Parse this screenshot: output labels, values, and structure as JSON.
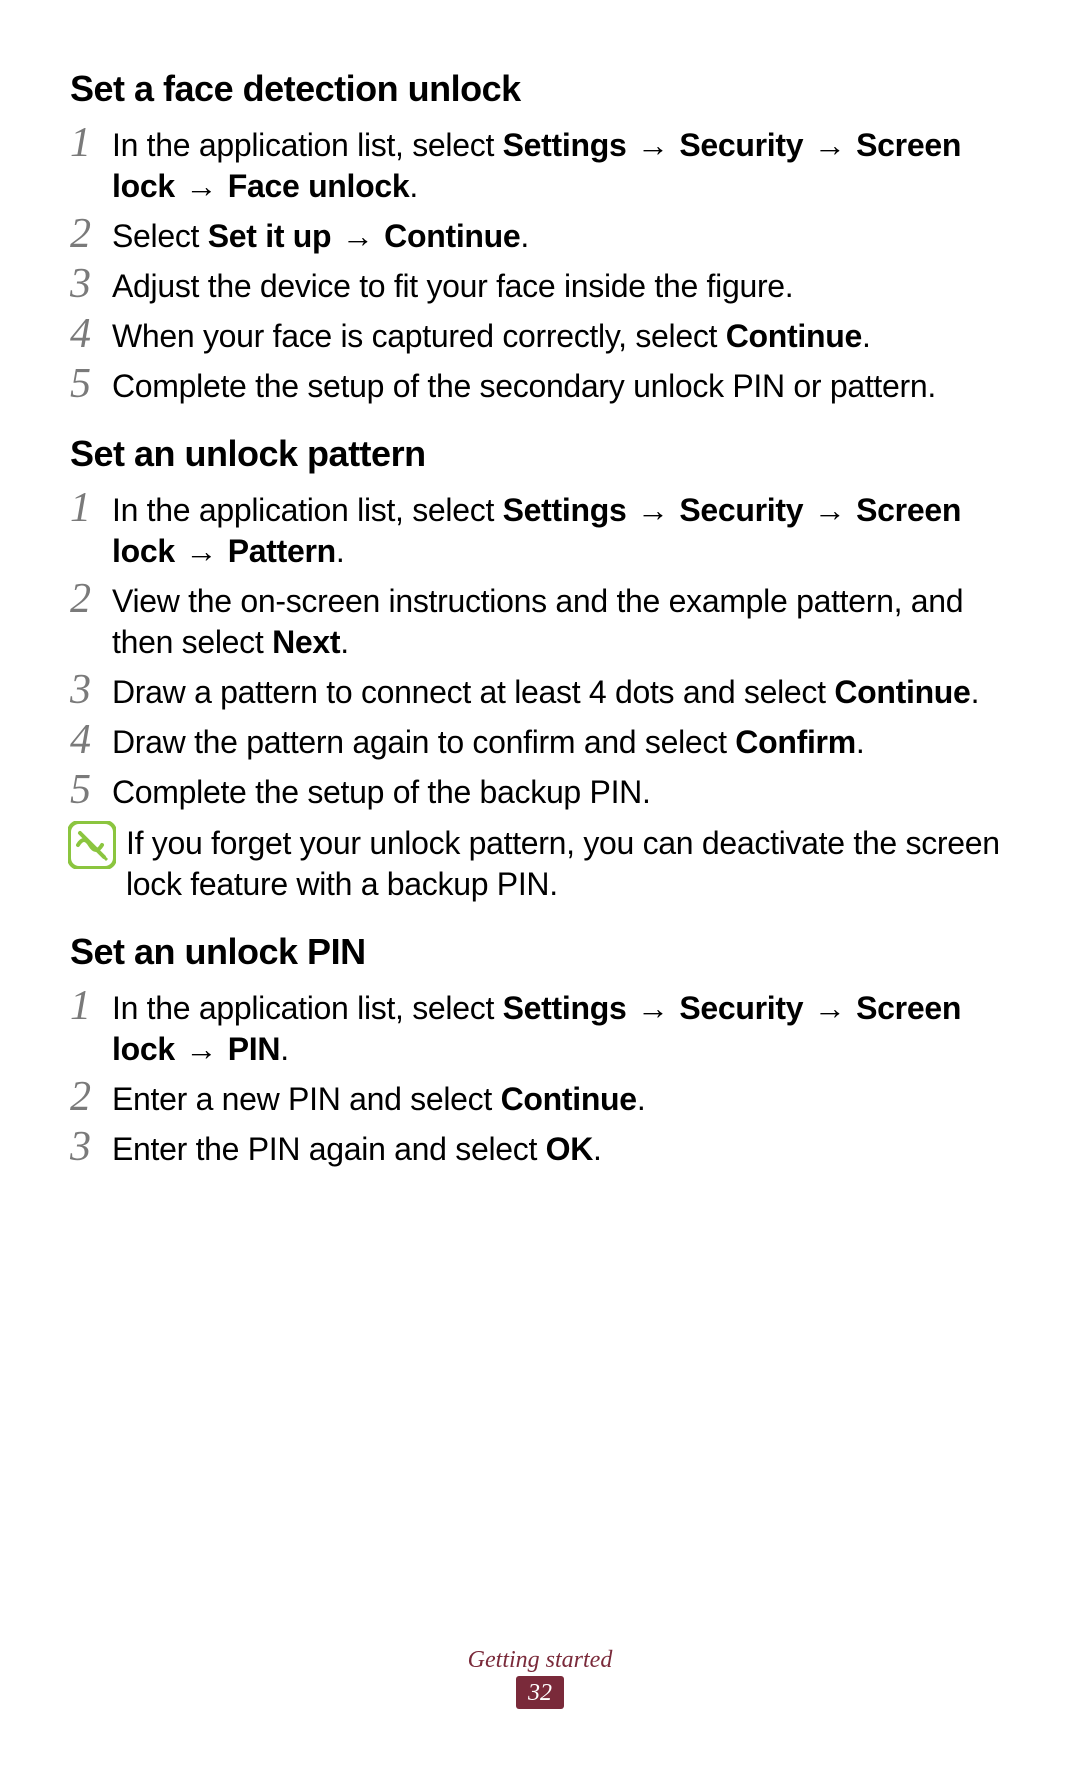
{
  "sectionA": {
    "heading": "Set a face detection unlock",
    "steps": {
      "s1": {
        "num": "1",
        "pre": "In the application list, select ",
        "b1": "Settings",
        "a1": " → ",
        "b2": "Security",
        "a2": " → ",
        "b3": "Screen lock",
        "a3": " → ",
        "b4": "Face unlock",
        "post": "."
      },
      "s2": {
        "num": "2",
        "pre": "Select ",
        "b1": "Set it up",
        "a1": " → ",
        "b2": "Continue",
        "post": "."
      },
      "s3": {
        "num": "3",
        "text": "Adjust the device to fit your face inside the figure."
      },
      "s4": {
        "num": "4",
        "pre": "When your face is captured correctly, select ",
        "b1": "Continue",
        "post": "."
      },
      "s5": {
        "num": "5",
        "text": "Complete the setup of the secondary unlock PIN or pattern."
      }
    }
  },
  "sectionB": {
    "heading": "Set an unlock pattern",
    "steps": {
      "s1": {
        "num": "1",
        "pre": "In the application list, select ",
        "b1": "Settings",
        "a1": " → ",
        "b2": "Security",
        "a2": " → ",
        "b3": "Screen lock",
        "a3": " → ",
        "b4": "Pattern",
        "post": "."
      },
      "s2": {
        "num": "2",
        "pre": "View the on-screen instructions and the example pattern, and then select ",
        "b1": "Next",
        "post": "."
      },
      "s3": {
        "num": "3",
        "pre": "Draw a pattern to connect at least 4 dots and select ",
        "b1": "Continue",
        "post": "."
      },
      "s4": {
        "num": "4",
        "pre": "Draw the pattern again to confirm and select ",
        "b1": "Confirm",
        "post": "."
      },
      "s5": {
        "num": "5",
        "text": "Complete the setup of the backup PIN."
      }
    },
    "note": "If you forget your unlock pattern, you can deactivate the screen lock feature with a backup PIN."
  },
  "sectionC": {
    "heading": "Set an unlock PIN",
    "steps": {
      "s1": {
        "num": "1",
        "pre": "In the application list, select ",
        "b1": "Settings",
        "a1": " → ",
        "b2": "Security",
        "a2": " → ",
        "b3": "Screen lock",
        "a3": " → ",
        "b4": "PIN",
        "post": "."
      },
      "s2": {
        "num": "2",
        "pre": "Enter a new PIN and select ",
        "b1": "Continue",
        "post": "."
      },
      "s3": {
        "num": "3",
        "pre": "Enter the PIN again and select ",
        "b1": "OK",
        "post": "."
      }
    }
  },
  "footer": {
    "section": "Getting started",
    "page": "32"
  }
}
